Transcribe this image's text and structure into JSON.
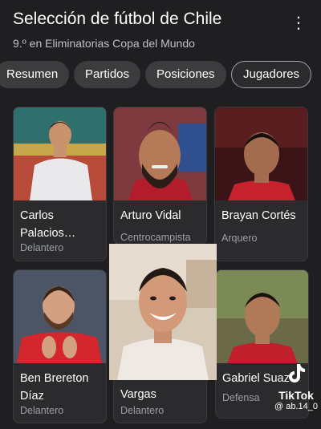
{
  "header": {
    "title": "Selección de fútbol de Chile",
    "subtitle": "9.º en Eliminatorias Copa del Mundo"
  },
  "tabs": [
    {
      "label": "Resumen"
    },
    {
      "label": "Partidos"
    },
    {
      "label": "Posiciones"
    },
    {
      "label": "Jugadores",
      "active": true
    }
  ],
  "players": [
    {
      "name": "Carlos Palacios…",
      "role": "Delantero"
    },
    {
      "name": "Arturo Vidal",
      "role": "Centrocampista"
    },
    {
      "name": "Brayan Cortés",
      "role": "Arquero"
    },
    {
      "name": "Ben Brereton Díaz",
      "role": "Delantero"
    },
    {
      "name": "Vargas",
      "role": "Delantero"
    },
    {
      "name": "Gabriel Suaz",
      "role": "Defensa"
    }
  ],
  "watermark": {
    "brand": "TikTok",
    "handle": "@ ab.14_0"
  },
  "colors": {
    "background": "#1f1f21",
    "card": "#2b2b2e",
    "chip": "#3c3c3e",
    "muted": "#9aa0a6"
  }
}
